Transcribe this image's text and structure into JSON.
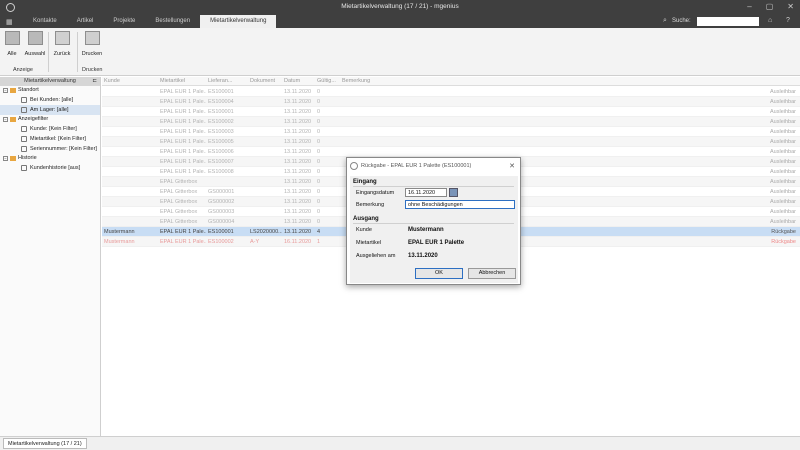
{
  "window": {
    "title": "Mietartikelverwaltung (17 / 21) - mgenius"
  },
  "menu": {
    "tabs": [
      "Kontakte",
      "Artikel",
      "Projekte",
      "Bestellungen",
      "Mietartikelverwaltung"
    ],
    "active_tab": 4,
    "search_label": "Suche:",
    "search_value": ""
  },
  "ribbon": {
    "buttons": {
      "alle": "Alle",
      "auswahl": "Auswahl",
      "zurueck": "Zurück",
      "drucken": "Drucken"
    },
    "groups": {
      "anzeige": "Anzeige",
      "drucken": "Drucken"
    }
  },
  "sidebar": {
    "header": "Mietartikelverwaltung",
    "groups": [
      {
        "label": "Standort",
        "items": [
          "Bei Kunden: [alle]",
          "Am Lager: [alle]"
        ]
      },
      {
        "label": "Anzeigefilter",
        "items": [
          "Kunde: [Kein Filter]",
          "Mietartikel: [Kein Filter]",
          "Seriennummer: [Kein Filter]"
        ]
      },
      {
        "label": "Historie",
        "items": [
          "Kundenhistorie [aus]"
        ]
      }
    ]
  },
  "table": {
    "headers": [
      "Kunde",
      "Mietartikel",
      "Lieferan...",
      "Dokument",
      "Datum",
      "Gültig...",
      "Bemerkung"
    ],
    "rows": [
      {
        "kunde": "",
        "artikel": "EPAL EUR 1 Pale...",
        "lief": "ES100001",
        "dok": "",
        "datum": "13.11.2020",
        "n": "0",
        "status": "Ausleihbar"
      },
      {
        "kunde": "",
        "artikel": "EPAL EUR 1 Pale...",
        "lief": "ES100004",
        "dok": "",
        "datum": "13.11.2020",
        "n": "0",
        "status": "Ausleihbar"
      },
      {
        "kunde": "",
        "artikel": "EPAL EUR 1 Pale...",
        "lief": "ES100001",
        "dok": "",
        "datum": "13.11.2020",
        "n": "0",
        "status": "Ausleihbar"
      },
      {
        "kunde": "",
        "artikel": "EPAL EUR 1 Pale...",
        "lief": "ES100002",
        "dok": "",
        "datum": "13.11.2020",
        "n": "0",
        "status": "Ausleihbar"
      },
      {
        "kunde": "",
        "artikel": "EPAL EUR 1 Pale...",
        "lief": "ES100003",
        "dok": "",
        "datum": "13.11.2020",
        "n": "0",
        "status": "Ausleihbar"
      },
      {
        "kunde": "",
        "artikel": "EPAL EUR 1 Pale...",
        "lief": "ES100005",
        "dok": "",
        "datum": "13.11.2020",
        "n": "0",
        "status": "Ausleihbar"
      },
      {
        "kunde": "",
        "artikel": "EPAL EUR 1 Pale...",
        "lief": "ES100006",
        "dok": "",
        "datum": "13.11.2020",
        "n": "0",
        "status": "Ausleihbar"
      },
      {
        "kunde": "",
        "artikel": "EPAL EUR 1 Pale...",
        "lief": "ES100007",
        "dok": "",
        "datum": "13.11.2020",
        "n": "0",
        "status": "Ausleihbar"
      },
      {
        "kunde": "",
        "artikel": "EPAL EUR 1 Pale...",
        "lief": "ES100008",
        "dok": "",
        "datum": "13.11.2020",
        "n": "0",
        "status": "Ausleihbar"
      },
      {
        "kunde": "",
        "artikel": "EPAL Gitterbox",
        "lief": "",
        "dok": "",
        "datum": "13.11.2020",
        "n": "0",
        "status": "Ausleihbar"
      },
      {
        "kunde": "",
        "artikel": "EPAL Gitterbox",
        "lief": "GS000001",
        "dok": "",
        "datum": "13.11.2020",
        "n": "0",
        "status": "Ausleihbar"
      },
      {
        "kunde": "",
        "artikel": "EPAL Gitterbox",
        "lief": "GS000002",
        "dok": "",
        "datum": "13.11.2020",
        "n": "0",
        "status": "Ausleihbar"
      },
      {
        "kunde": "",
        "artikel": "EPAL Gitterbox",
        "lief": "GS000003",
        "dok": "",
        "datum": "13.11.2020",
        "n": "0",
        "status": "Ausleihbar"
      },
      {
        "kunde": "",
        "artikel": "EPAL Gitterbox",
        "lief": "GS000004",
        "dok": "",
        "datum": "13.11.2020",
        "n": "0",
        "status": "Ausleihbar"
      },
      {
        "kunde": "Mustermann",
        "artikel": "EPAL EUR 1 Pale...",
        "lief": "ES100001",
        "dok": "LS2020000...",
        "datum": "13.11.2020",
        "n": "4",
        "status": "Rückgabe",
        "cls": "sel"
      },
      {
        "kunde": "Mustermann",
        "artikel": "EPAL EUR 1 Pale...",
        "lief": "ES100002",
        "dok": "A-Y",
        "datum": "16.11.2020",
        "n": "1",
        "status": "Rückgabe",
        "cls": "red"
      }
    ]
  },
  "statusbar": {
    "tab": "Mietartikelverwaltung (17 / 21)"
  },
  "dialog": {
    "title": "Rückgabe - EPAL EUR 1 Palette (ES100001)",
    "close": "✕",
    "section_in": "Eingang",
    "label_date": "Eingangsdatum",
    "value_date": "16.11.2020",
    "label_note": "Bemerkung",
    "value_note": "ohne Beschädigungen",
    "section_out": "Ausgang",
    "label_customer": "Kunde",
    "value_customer": "Mustermann",
    "label_article": "Mietartikel",
    "value_article": "EPAL EUR 1 Palette",
    "label_lent": "Ausgeliehen am",
    "value_lent": "13.11.2020",
    "ok": "OK",
    "cancel": "Abbrechen"
  }
}
